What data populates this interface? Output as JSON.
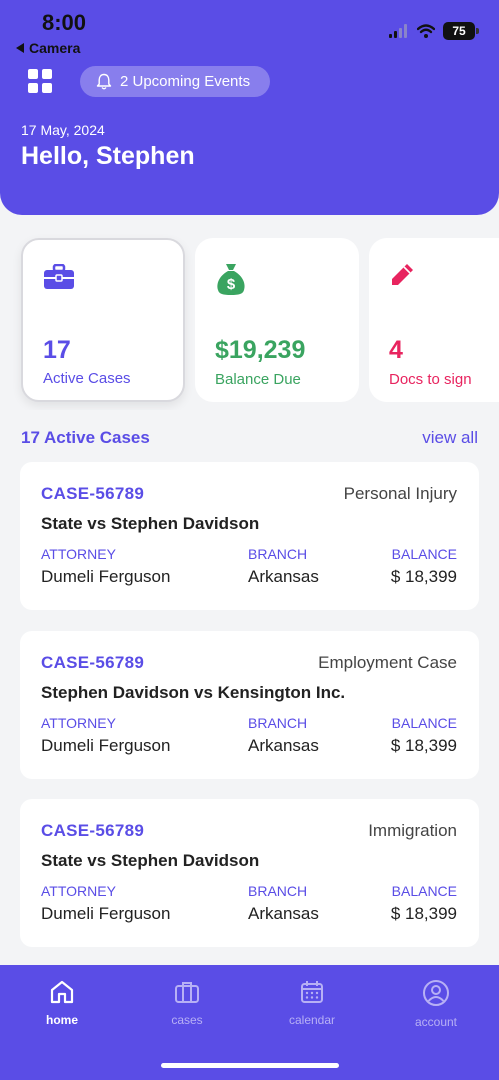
{
  "status_bar": {
    "time": "8:00",
    "back_label": "Camera",
    "battery": "75"
  },
  "header": {
    "events_label": "2 Upcoming Events",
    "date": "17 May, 2024",
    "greeting": "Hello, Stephen"
  },
  "stats": [
    {
      "value": "17",
      "label": "Active Cases",
      "color": "#5a4de6",
      "icon": "briefcase-icon"
    },
    {
      "value": "$19,239",
      "label": "Balance Due",
      "color": "#3aa460",
      "icon": "money-bag-icon"
    },
    {
      "value": "4",
      "label": "Docs to sign",
      "color": "#e8245f",
      "icon": "pencil-icon"
    }
  ],
  "section": {
    "title": "17 Active Cases",
    "view_all": "view all"
  },
  "columns": {
    "attorney": "ATTORNEY",
    "branch": "BRANCH",
    "balance": "BALANCE"
  },
  "cases": [
    {
      "id": "CASE-56789",
      "type": "Personal Injury",
      "title": "State vs Stephen Davidson",
      "attorney": "Dumeli Ferguson",
      "branch": "Arkansas",
      "balance": "$ 18,399"
    },
    {
      "id": "CASE-56789",
      "type": "Employment Case",
      "title": "Stephen Davidson vs Kensington Inc.",
      "attorney": "Dumeli Ferguson",
      "branch": "Arkansas",
      "balance": "$ 18,399"
    },
    {
      "id": "CASE-56789",
      "type": "Immigration",
      "title": "State vs Stephen Davidson",
      "attorney": "Dumeli Ferguson",
      "branch": "Arkansas",
      "balance": "$ 18,399"
    }
  ],
  "nav": [
    {
      "label": "home",
      "icon": "home-icon",
      "active": true
    },
    {
      "label": "cases",
      "icon": "briefcase-icon",
      "active": false
    },
    {
      "label": "calendar",
      "icon": "calendar-icon",
      "active": false
    },
    {
      "label": "account",
      "icon": "account-icon",
      "active": false
    }
  ]
}
